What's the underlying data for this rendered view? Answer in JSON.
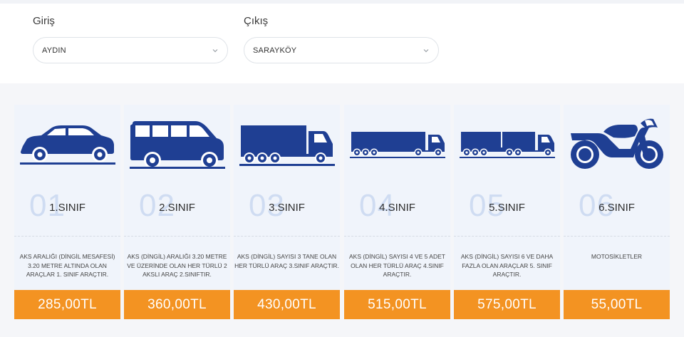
{
  "form": {
    "entry": {
      "label": "Giriş",
      "value": "AYDIN"
    },
    "exit": {
      "label": "Çıkış",
      "value": "SARAYKÖY"
    }
  },
  "cards": [
    {
      "num": "01",
      "cls": "1.SINIF",
      "desc": "AKS ARALIĞI (DİNGİL MESAFESİ) 3.20 METRE ALTINDA OLAN ARAÇLAR 1. SINIF ARAÇTIR.",
      "price": "285,00TL",
      "icon": "car-icon"
    },
    {
      "num": "02",
      "cls": "2.SINIF",
      "desc": "AKS (DİNGİL) ARALIĞI 3.20 METRE VE ÜZERİNDE OLAN HER TÜRLÜ 2 AKSLI ARAÇ 2.SINIFTIR.",
      "price": "360,00TL",
      "icon": "minibus-icon"
    },
    {
      "num": "03",
      "cls": "3.SINIF",
      "desc": "AKS (DİNGİL) SAYISI 3 TANE OLAN HER TÜRLÜ ARAÇ 3.SINIF ARAÇTIR.",
      "price": "430,00TL",
      "icon": "truck-icon"
    },
    {
      "num": "04",
      "cls": "4.SINIF",
      "desc": "AKS (DİNGİL) SAYISI 4 VE 5 ADET OLAN HER TÜRLÜ ARAÇ 4.SINIF ARAÇTIR.",
      "price": "515,00TL",
      "icon": "trailer-truck-icon"
    },
    {
      "num": "05",
      "cls": "5.SINIF",
      "desc": "AKS (DİNGİL) SAYISI 6 VE DAHA FAZLA OLAN ARAÇLAR 5. SINIF ARAÇTIR.",
      "price": "575,00TL",
      "icon": "long-trailer-truck-icon"
    },
    {
      "num": "06",
      "cls": "6.SINIF",
      "desc": "MOTOSİKLETLER",
      "price": "55,00TL",
      "icon": "motorcycle-icon"
    }
  ],
  "colors": {
    "accent": "#f39322",
    "vehicle": "#1f3f93",
    "number": "#cfdcf2"
  }
}
